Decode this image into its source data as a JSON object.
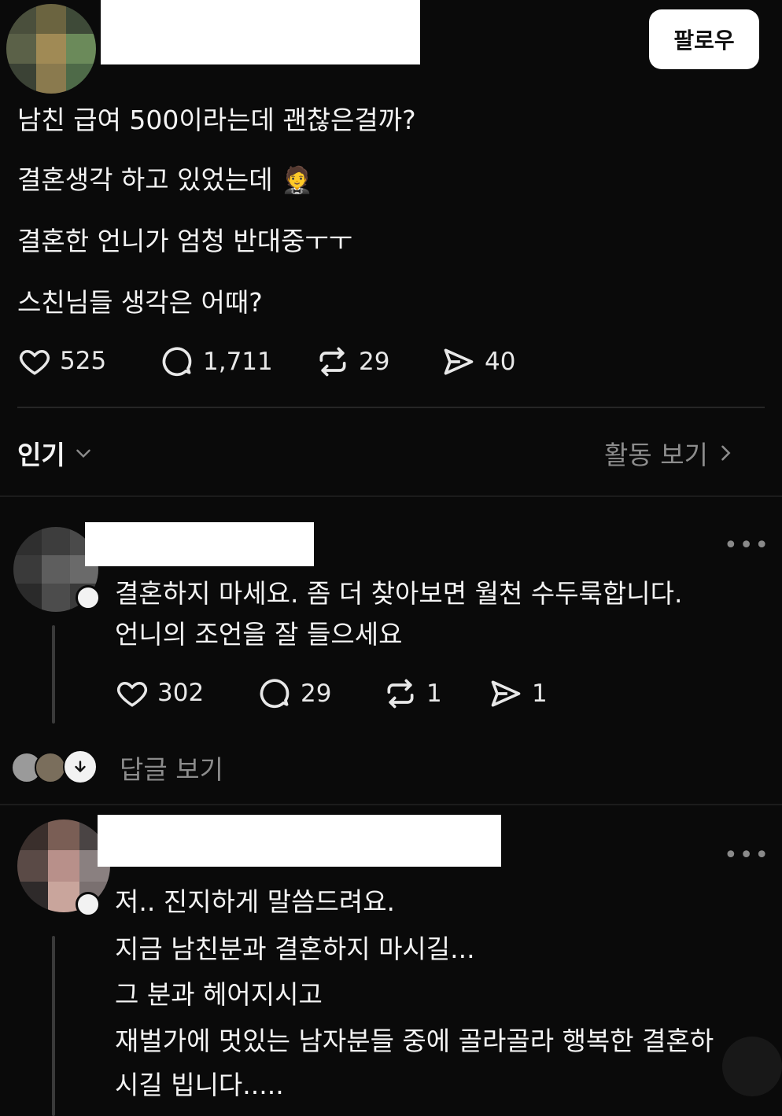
{
  "post": {
    "follow_label": "팔로우",
    "lines": [
      "남친 급여 500이라는데 괜찮은걸까?",
      "결혼생각 하고 있었는데 🤵",
      "결혼한 언니가 엄청 반대중ㅜㅜ",
      "스친님들 생각은 어때?"
    ],
    "actions": {
      "likes": "525",
      "replies": "1,711",
      "reposts": "29",
      "shares": "40"
    }
  },
  "sort_bar": {
    "sort_label": "인기",
    "activity_label": "활동 보기"
  },
  "comments": [
    {
      "lines": [
        "결혼하지 마세요. 좀 더 찾아보면 월천 수두룩합니다.",
        "언니의 조언을 잘 들으세요"
      ],
      "actions": {
        "likes": "302",
        "replies": "29",
        "reposts": "1",
        "shares": "1"
      },
      "view_replies_label": "답글 보기"
    },
    {
      "lines": [
        "저.. 진지하게 말씀드려요.",
        "지금 남친분과 결혼하지 마시길...",
        "그 분과 헤어지시고",
        "재벌가에 멋있는 남자분들 중에 골라골라 행복한 결혼하",
        "시길 빕니다....."
      ]
    }
  ],
  "more_glyph": "•••",
  "icons": [
    "heart-icon",
    "comment-icon",
    "repost-icon",
    "share-icon",
    "chevron-down-icon",
    "chevron-right-icon",
    "arrow-down-icon"
  ]
}
